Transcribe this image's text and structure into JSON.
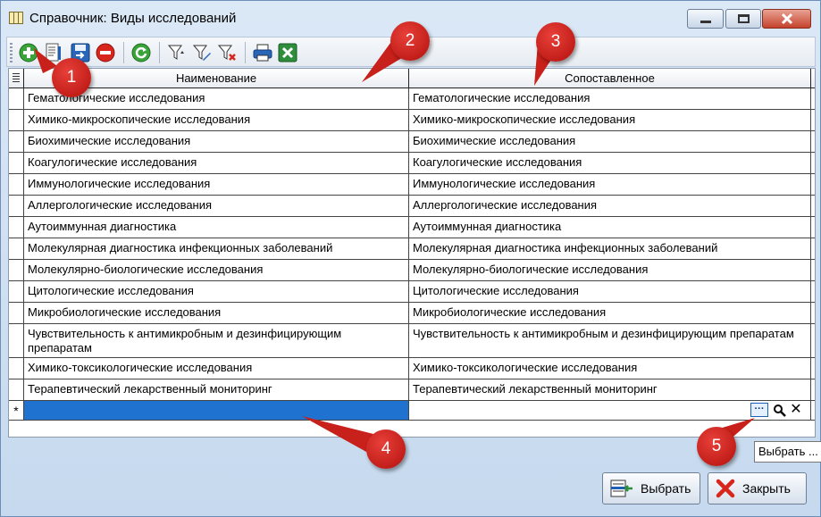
{
  "window": {
    "title": "Справочник: Виды исследований"
  },
  "toolbar": {
    "buttons": [
      {
        "name": "add-icon"
      },
      {
        "name": "edit-icon"
      },
      {
        "name": "save-icon"
      },
      {
        "name": "delete-icon"
      },
      {
        "name": "refresh-icon"
      },
      {
        "name": "filter-icon"
      },
      {
        "name": "edit-filter-icon"
      },
      {
        "name": "clear-filter-icon"
      },
      {
        "name": "print-icon"
      },
      {
        "name": "excel-icon"
      }
    ]
  },
  "grid": {
    "columns": [
      "Наименование",
      "Сопоставленное"
    ],
    "rows": [
      [
        "Гематологические исследования",
        "Гематологические исследования"
      ],
      [
        "Химико-микроскопические исследования",
        "Химико-микроскопические исследования"
      ],
      [
        "Биохимические исследования",
        "Биохимические исследования"
      ],
      [
        "Коагулогические исследования",
        "Коагулогические исследования"
      ],
      [
        "Иммунологические исследования",
        "Иммунологические исследования"
      ],
      [
        "Аллергологические исследования",
        "Аллергологические исследования"
      ],
      [
        "Аутоиммунная диагностика",
        "Аутоиммунная диагностика"
      ],
      [
        "Молекулярная диагностика инфекционных заболеваний",
        "Молекулярная диагностика инфекционных заболеваний"
      ],
      [
        "Молекулярно-биологические исследования",
        "Молекулярно-биологические исследования"
      ],
      [
        "Цитологические исследования",
        "Цитологические исследования"
      ],
      [
        "Микробиологические исследования",
        "Микробиологические исследования"
      ],
      [
        "Чувствительность к антимикробным и дезинфицирующим препаратам",
        "Чувствительность к антимикробным и дезинфицирующим препаратам"
      ],
      [
        "Химико-токсикологические исследования",
        "Химико-токсикологические исследования"
      ],
      [
        "Терапевтический лекарственный мониторинг",
        "Терапевтический лекарственный мониторинг"
      ]
    ],
    "new_row_marker": "*",
    "ellipsis_label": "···",
    "clear_label": "✕"
  },
  "tooltip": "Выбрать ...",
  "footer": {
    "select_label": "Выбрать",
    "close_label": "Закрыть"
  },
  "callouts": [
    "1",
    "2",
    "3",
    "4",
    "5"
  ],
  "colors": {
    "selection": "#1f72d0",
    "callout": "#c8201a"
  }
}
